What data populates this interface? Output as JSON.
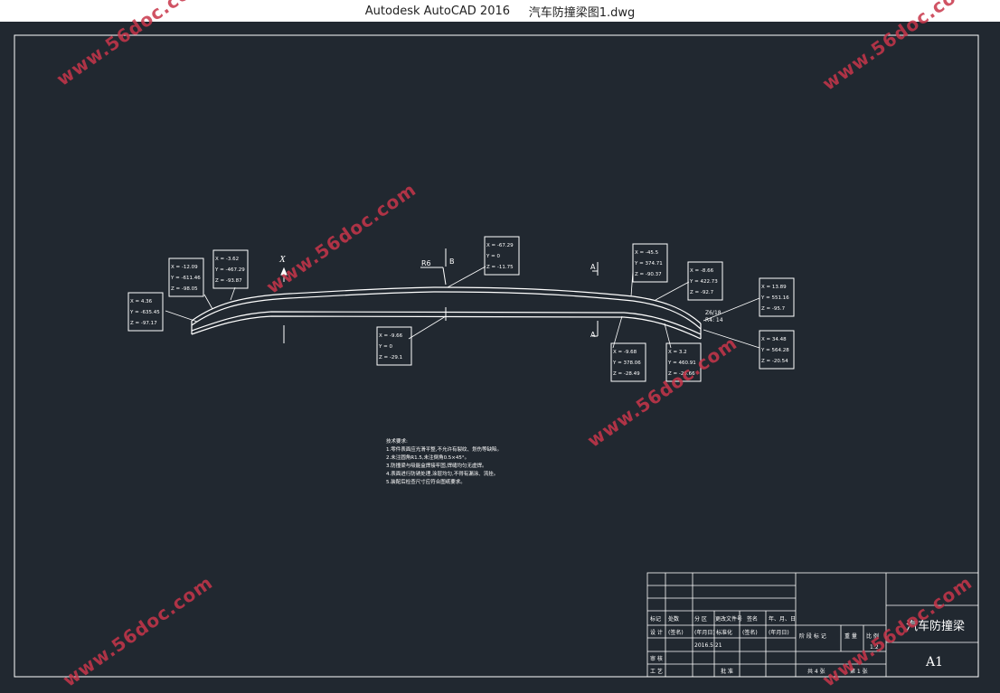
{
  "window": {
    "app_title": "Autodesk AutoCAD 2016",
    "document_title": "汽车防撞梁图1.dwg"
  },
  "colors": {
    "background": "#212830",
    "lines": "#ffffff",
    "watermark": "#c8364a"
  },
  "watermark": "www.56doc.com",
  "drawing": {
    "axis_label": "X",
    "section_label_a": "A",
    "section_label_b": "B",
    "radius_label": "R6",
    "angle_label_1": "Z6/18",
    "angle_label_2": "R4: 14",
    "coordinate_callouts": [
      {
        "x": "X = 4.36",
        "y": "Y = -635.45",
        "z": "Z = -97.17"
      },
      {
        "x": "X = -12.09",
        "y": "Y = -611.46",
        "z": "Z = -98.05"
      },
      {
        "x": "X = -3.62",
        "y": "Y = -467.29",
        "z": "Z = -93.87"
      },
      {
        "x": "X = -67.29",
        "y": "Y = 0",
        "z": "Z = -11.75"
      },
      {
        "x": "X = -9.66",
        "y": "Y = 0",
        "z": "Z = -29.1"
      },
      {
        "x": "X = -45.5",
        "y": "Y = 374.71",
        "z": "Z = -90.37"
      },
      {
        "x": "X = -8.66",
        "y": "Y = 422.73",
        "z": "Z = -92.7"
      },
      {
        "x": "X = 13.89",
        "y": "Y = 551.16",
        "z": "Z = -95.7"
      },
      {
        "x": "X = -9.68",
        "y": "Y = 378.06",
        "z": "Z = -28.49"
      },
      {
        "x": "X = 3.2",
        "y": "Y = 460.91",
        "z": "Z = -25.66"
      },
      {
        "x": "X = 34.48",
        "y": "Y = 564.28",
        "z": "Z = -20.54"
      }
    ],
    "notes": {
      "heading": "技术要求:",
      "lines": [
        "1.零件表面应光滑平整,不允许有裂纹、划伤等缺陷。",
        "2.未注圆角R1.5,未注倒角0.5×45°。",
        "3.防撞梁与吸能盒焊接牢固,焊缝均匀无虚焊。",
        "4.表面进行防锈处理,涂层均匀,不得有漏涂、流挂。",
        "5.装配后检查尺寸应符合图纸要求。"
      ]
    }
  },
  "title_block": {
    "part_name": "汽车防撞梁",
    "sheet_size": "A1",
    "row_headers": [
      "标记",
      "处数",
      "分 区",
      "更改文件号",
      "签名",
      "年、月、日"
    ],
    "row_values": [
      "(签名)",
      "(年月日)",
      "标准化",
      "(签名)",
      "(年月日)"
    ],
    "stage_headers": [
      "阶 段 标 记",
      "重 量",
      "比 例"
    ],
    "labels": {
      "design": "设 计",
      "drafter": "2016.5.21",
      "check": "审 核",
      "process": "工 艺",
      "approve": "批 准",
      "scale": "1:2",
      "sheet_count": "共 4 张",
      "sheet_index": "第 1 张"
    }
  }
}
